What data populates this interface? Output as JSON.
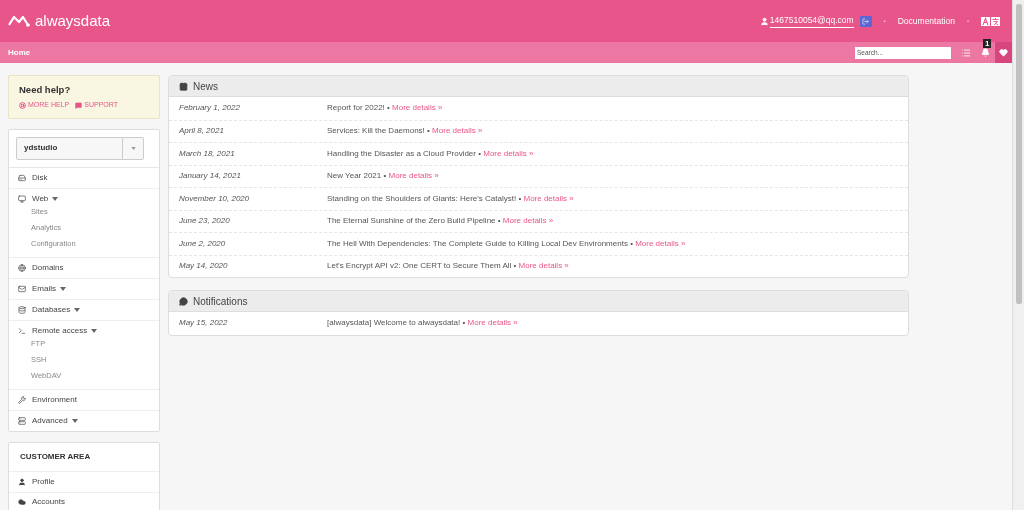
{
  "header": {
    "brand": "alwaysdata",
    "user": "1467510054@qq.com",
    "documentation": "Documentation",
    "separator": "•"
  },
  "subnav": {
    "title": "Home",
    "search": {
      "placeholder": "Search..."
    },
    "notifications_badge": "1"
  },
  "help": {
    "title": "Need help?",
    "links": [
      "MORE HELP",
      "SUPPORT"
    ]
  },
  "account_select": {
    "value": "ydstudio"
  },
  "sidebar": {
    "items": [
      {
        "label": "Disk",
        "dropdown": false
      },
      {
        "label": "Web",
        "dropdown": true,
        "children": [
          {
            "label": "Sites"
          },
          {
            "label": "Analytics"
          },
          {
            "label": "Configuration"
          }
        ]
      },
      {
        "label": "Domains",
        "dropdown": false
      },
      {
        "label": "Emails",
        "dropdown": true
      },
      {
        "label": "Databases",
        "dropdown": true
      },
      {
        "label": "Remote access",
        "dropdown": true,
        "children": [
          {
            "label": "FTP"
          },
          {
            "label": "SSH"
          },
          {
            "label": "WebDAV"
          }
        ]
      },
      {
        "label": "Environment",
        "dropdown": false
      },
      {
        "label": "Advanced",
        "dropdown": true
      }
    ]
  },
  "customer_area": {
    "title": "CUSTOMER AREA",
    "items": [
      {
        "label": "Profile"
      },
      {
        "label": "Accounts"
      }
    ]
  },
  "news": {
    "title": "News",
    "rows": [
      {
        "date": "February 1, 2022",
        "title": "Report for 2022!",
        "link": "More details »"
      },
      {
        "date": "April 8, 2021",
        "title": "Services: Kill the Daemons!",
        "link": "More details »"
      },
      {
        "date": "March 18, 2021",
        "title": "Handling the Disaster as a Cloud Provider",
        "link": "More details »"
      },
      {
        "date": "January 14, 2021",
        "title": "New Year 2021",
        "link": "More details »"
      },
      {
        "date": "November 10, 2020",
        "title": "Standing on the Shoulders of Giants: Here's Catalyst!",
        "link": "More details »"
      },
      {
        "date": "June 23, 2020",
        "title": "The Eternal Sunshine of the Zero Build Pipeline",
        "link": "More details »"
      },
      {
        "date": "June 2, 2020",
        "title": "The Hell With Dependencies: The Complete Guide to Killing Local Dev Environments",
        "link": "More details »"
      },
      {
        "date": "May 14, 2020",
        "title": "Let's Encrypt API v2: One CERT to Secure Them All",
        "link": "More details »"
      }
    ]
  },
  "notifications": {
    "title": "Notifications",
    "rows": [
      {
        "date": "May 15, 2022",
        "title": "[alwaysdata] Welcome to alwaysdata!",
        "link": "More details »"
      }
    ]
  }
}
